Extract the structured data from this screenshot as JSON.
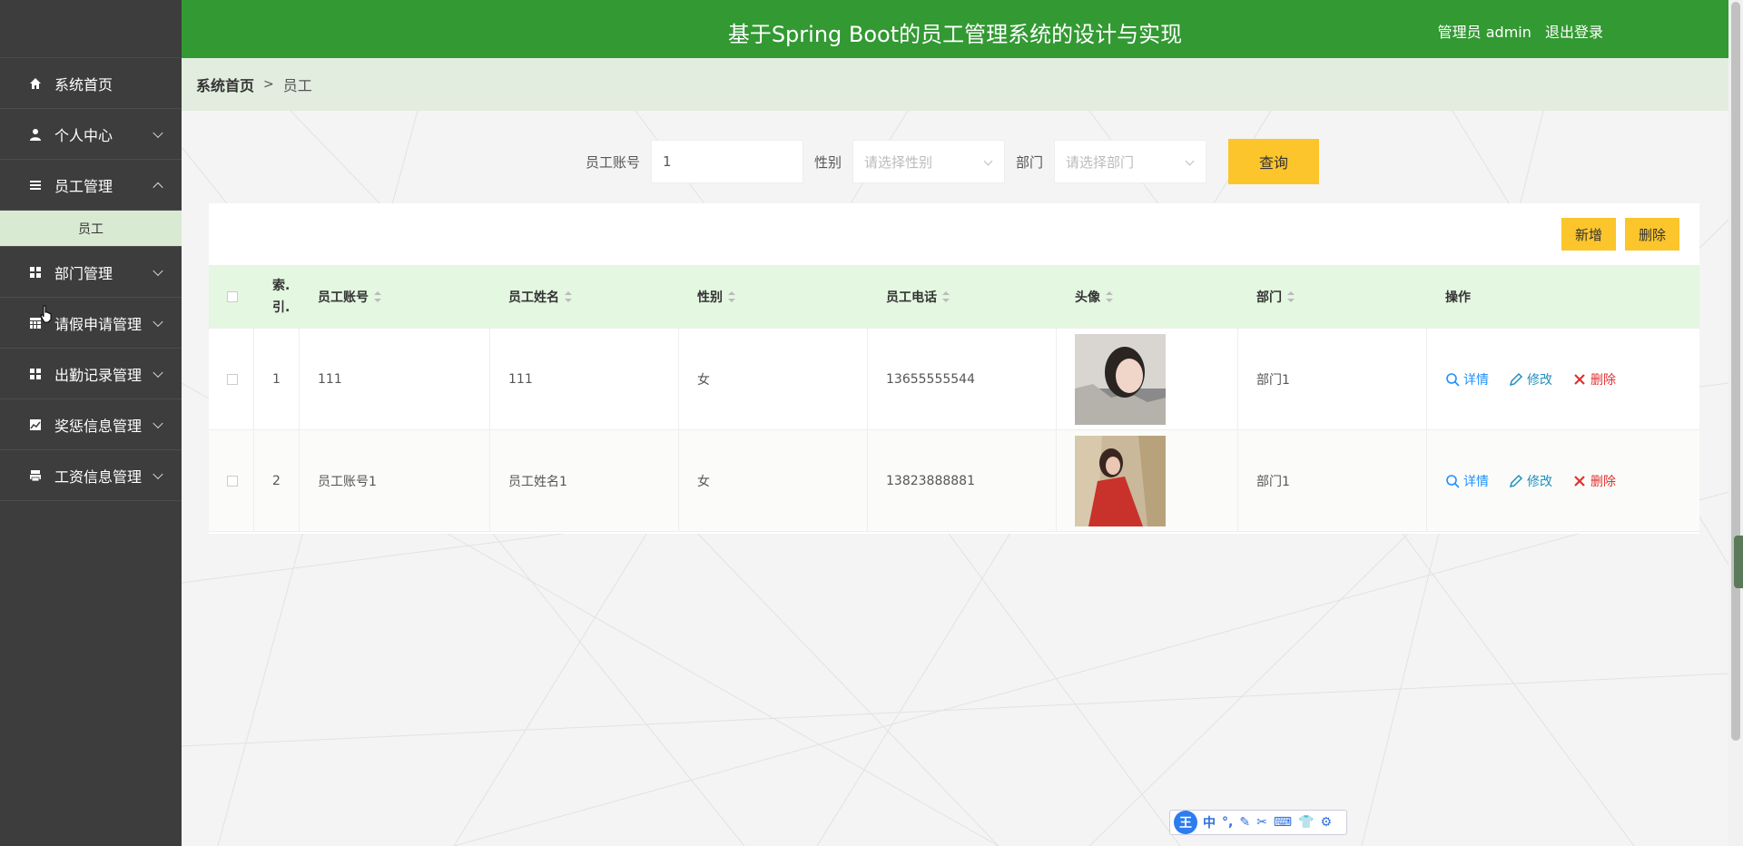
{
  "header": {
    "title": "基于Spring Boot的员工管理系统的设计与实现",
    "user_label": "管理员 admin",
    "logout": "退出登录"
  },
  "sidebar": {
    "items": [
      {
        "label": "系统首页",
        "icon": "home-icon"
      },
      {
        "label": "个人中心",
        "icon": "user-icon"
      },
      {
        "label": "员工管理",
        "icon": "list-icon",
        "expanded": true,
        "sub": [
          "员工"
        ]
      },
      {
        "label": "部门管理",
        "icon": "grid-icon"
      },
      {
        "label": "请假申请管理",
        "icon": "table-icon"
      },
      {
        "label": "出勤记录管理",
        "icon": "grid-icon"
      },
      {
        "label": "奖惩信息管理",
        "icon": "chart-icon"
      },
      {
        "label": "工资信息管理",
        "icon": "printer-icon"
      }
    ]
  },
  "breadcrumb": {
    "root": "系统首页",
    "sep": ">",
    "current": "员工"
  },
  "search": {
    "account_label": "员工账号",
    "account_value": "1",
    "gender_label": "性别",
    "gender_placeholder": "请选择性别",
    "dept_label": "部门",
    "dept_placeholder": "请选择部门",
    "query_button": "查询"
  },
  "toolbar": {
    "add": "新增",
    "delete": "删除"
  },
  "table": {
    "headers": {
      "index": "索.\n引.",
      "account": "员工账号",
      "name": "员工姓名",
      "gender": "性别",
      "phone": "员工电话",
      "avatar": "头像",
      "dept": "部门",
      "ops": "操作"
    },
    "rows": [
      {
        "index": "1",
        "account": "111",
        "name": "111",
        "gender": "女",
        "phone": "13655555544",
        "dept": "部门1"
      },
      {
        "index": "2",
        "account": "员工账号1",
        "name": "员工姓名1",
        "gender": "女",
        "phone": "13823888881",
        "dept": "部门1"
      }
    ],
    "ops": {
      "detail": "详情",
      "edit": "修改",
      "remove": "删除"
    }
  },
  "ime": {
    "logo": "王",
    "mode": "中"
  },
  "colors": {
    "header_bg": "#339933",
    "sidebar_bg": "#3d3d3d",
    "accent_yellow": "#fcc52c",
    "table_head_bg": "#e4f7e1"
  }
}
